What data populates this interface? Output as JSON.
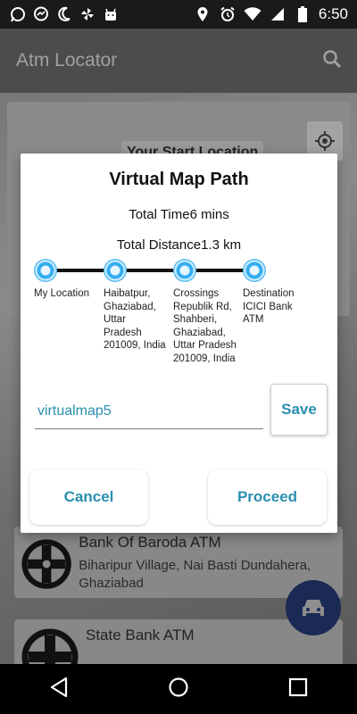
{
  "status_bar": {
    "time": "6:50",
    "left_icons": [
      "whatsapp-icon",
      "messenger-icon",
      "moon-icon",
      "pinwheel-icon",
      "android-icon"
    ],
    "right_icons": [
      "location-icon",
      "alarm-icon",
      "wifi-icon",
      "signal-icon",
      "battery-icon"
    ]
  },
  "app_bar": {
    "title": "Atm Locator"
  },
  "map": {
    "start_location": "Your Start Location"
  },
  "atm_list": [
    {
      "name": "Bank Of Baroda ATM",
      "address": "Biharipur Village, Nai Basti Dundahera, Ghaziabad"
    },
    {
      "name": "State Bank ATM",
      "address": ""
    }
  ],
  "dialog": {
    "title": "Virtual Map Path",
    "total_time": "Total Time6 mins",
    "total_distance": "Total Distance1.3 km",
    "path_nodes": [
      {
        "label": "My Location"
      },
      {
        "label": "Haibatpur, Ghaziabad, Uttar Pradesh 201009, India"
      },
      {
        "label": "Crossings Republik Rd, Shahberi, Ghaziabad, Uttar Pradesh 201009, India"
      },
      {
        "label": "Destination ICICI Bank ATM"
      }
    ],
    "map_name_value": "virtualmap5",
    "save_label": "Save",
    "cancel_label": "Cancel",
    "proceed_label": "Proceed"
  },
  "colors": {
    "accent": "#2a8fb0",
    "fab": "#1b2a55",
    "node": "#33aef0"
  }
}
